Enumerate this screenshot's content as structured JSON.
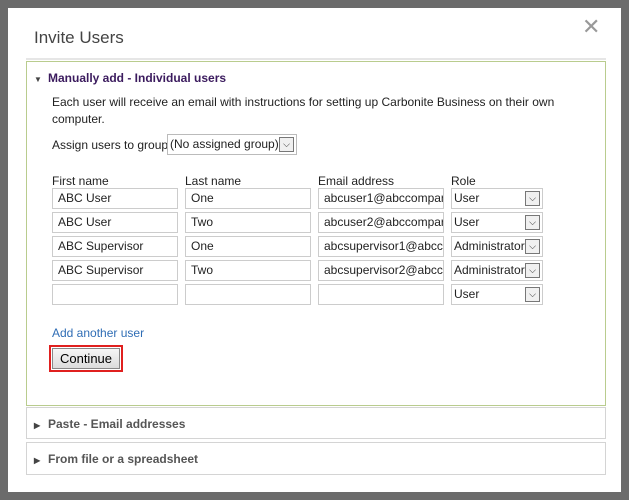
{
  "dialog": {
    "title": "Invite Users",
    "close_icon": "close-icon"
  },
  "manual": {
    "header": "Manually add - Individual users",
    "description": "Each user will receive an email with instructions for setting up Carbonite Business on their own computer.",
    "group_label": "Assign users to group",
    "group_value": "(No assigned group)",
    "columns": [
      "First name",
      "Last name",
      "Email address",
      "Role"
    ],
    "rows": [
      {
        "first": "ABC User",
        "last": "One",
        "email": "abcuser1@abccompar",
        "role": "User"
      },
      {
        "first": "ABC User",
        "last": "Two",
        "email": "abcuser2@abccompar",
        "role": "User"
      },
      {
        "first": "ABC Supervisor",
        "last": "One",
        "email": "abcsupervisor1@abcc",
        "role": "Administrator"
      },
      {
        "first": "ABC Supervisor",
        "last": "Two",
        "email": "abcsupervisor2@abcc",
        "role": "Administrator"
      },
      {
        "first": "",
        "last": "",
        "email": "",
        "role": "User"
      }
    ],
    "add_link": "Add another user",
    "continue": "Continue"
  },
  "paste": {
    "header": "Paste - Email addresses"
  },
  "file": {
    "header": "From file or a spreadsheet"
  }
}
